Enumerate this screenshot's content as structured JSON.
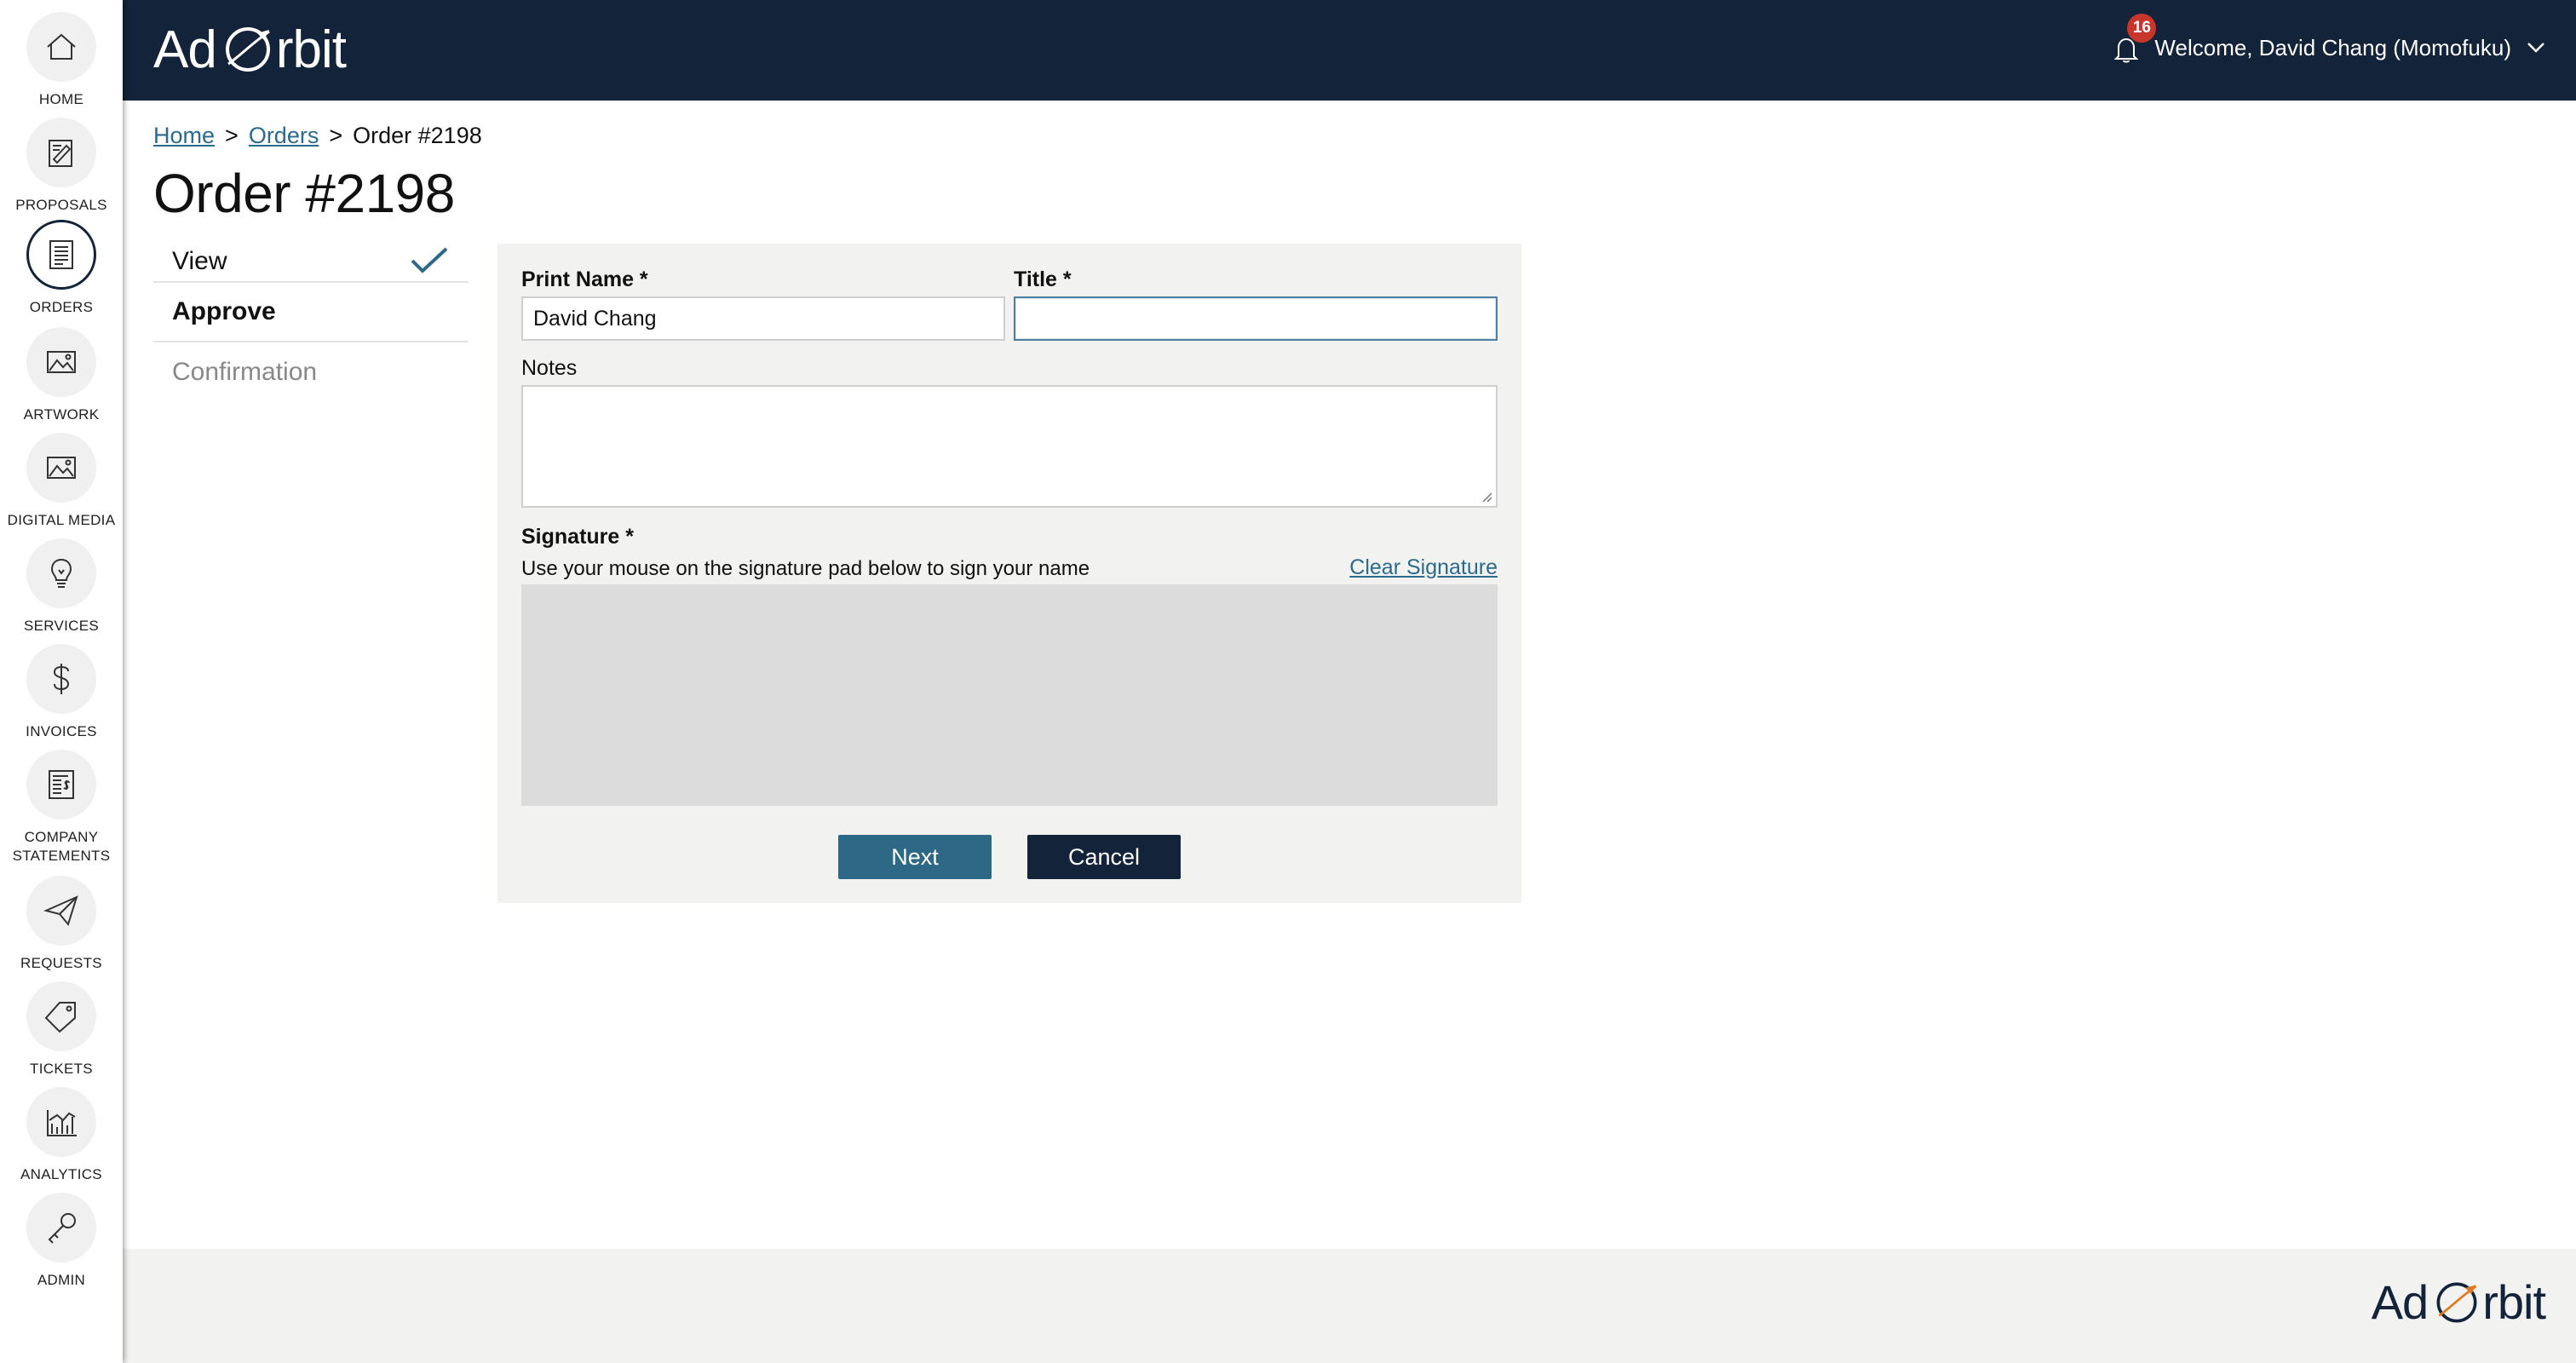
{
  "app": {
    "logo_text_1": "Ad",
    "logo_text_2": "rbit"
  },
  "colors": {
    "navy": "#13233a",
    "accent": "#2d6886",
    "link": "#2a6a8e",
    "badge": "#c8362b"
  },
  "sidebar": {
    "items": [
      {
        "label": "HOME",
        "icon": "home-icon"
      },
      {
        "label": "PROPOSALS",
        "icon": "proposals-icon"
      },
      {
        "label": "ORDERS",
        "icon": "orders-icon",
        "active": true
      },
      {
        "label": "ARTWORK",
        "icon": "artwork-icon"
      },
      {
        "label": "DIGITAL MEDIA",
        "icon": "digital-media-icon"
      },
      {
        "label": "SERVICES",
        "icon": "services-icon"
      },
      {
        "label": "INVOICES",
        "icon": "invoices-icon"
      },
      {
        "label": "COMPANY STATEMENTS",
        "icon": "company-statements-icon"
      },
      {
        "label": "REQUESTS",
        "icon": "requests-icon"
      },
      {
        "label": "TICKETS",
        "icon": "tickets-icon"
      },
      {
        "label": "ANALYTICS",
        "icon": "analytics-icon"
      },
      {
        "label": "ADMIN",
        "icon": "admin-icon"
      }
    ]
  },
  "header": {
    "notification_count": "16",
    "welcome": "Welcome, David Chang (Momofuku)"
  },
  "breadcrumb": {
    "home": "Home",
    "orders": "Orders",
    "current": "Order #2198",
    "separator": ">"
  },
  "page": {
    "title": "Order #2198"
  },
  "steps": {
    "view": "View",
    "approve": "Approve",
    "confirmation": "Confirmation"
  },
  "form": {
    "print_name_label": "Print Name *",
    "print_name_value": "David Chang",
    "title_label": "Title *",
    "title_value": "",
    "notes_label": "Notes",
    "notes_value": "",
    "signature_label": "Signature *",
    "signature_helper": "Use your mouse on the signature pad below to sign your name",
    "clear_signature": "Clear Signature",
    "next_label": "Next",
    "cancel_label": "Cancel"
  }
}
